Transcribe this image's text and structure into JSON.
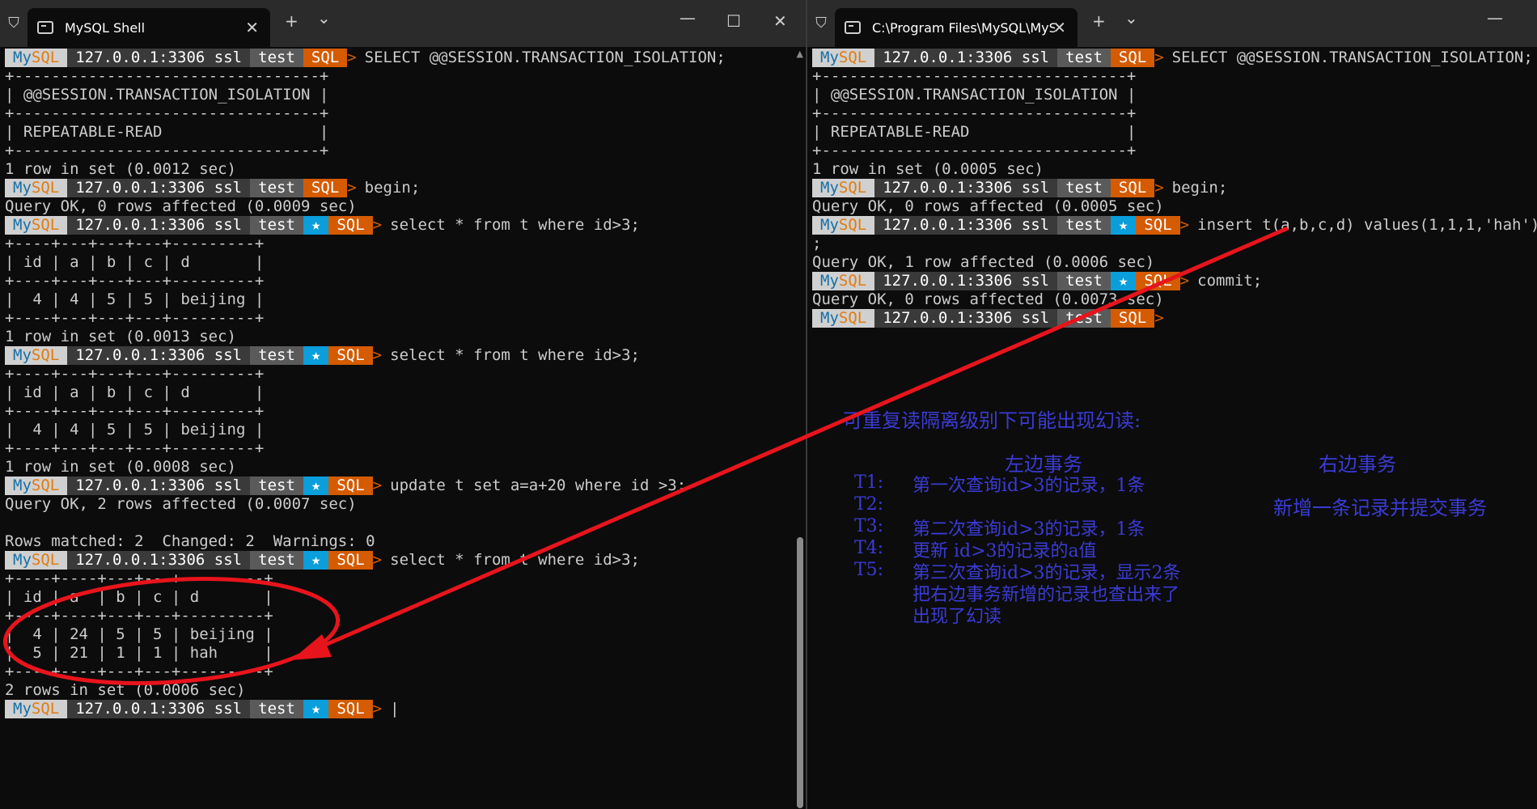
{
  "left_window": {
    "tab_title": "MySQL Shell",
    "lines": [
      {
        "type": "prompt",
        "star": false,
        "cmd": "SELECT @@SESSION.TRANSACTION_ISOLATION;"
      },
      {
        "type": "text",
        "text": "+---------------------------------+"
      },
      {
        "type": "text",
        "text": "| @@SESSION.TRANSACTION_ISOLATION |"
      },
      {
        "type": "text",
        "text": "+---------------------------------+"
      },
      {
        "type": "text",
        "text": "| REPEATABLE-READ                 |"
      },
      {
        "type": "text",
        "text": "+---------------------------------+"
      },
      {
        "type": "text",
        "text": "1 row in set (0.0012 sec)"
      },
      {
        "type": "prompt",
        "star": false,
        "cmd": "begin;"
      },
      {
        "type": "text",
        "text": "Query OK, 0 rows affected (0.0009 sec)"
      },
      {
        "type": "prompt",
        "star": true,
        "cmd": "select * from t where id>3;"
      },
      {
        "type": "text",
        "text": "+----+---+---+---+---------+"
      },
      {
        "type": "text",
        "text": "| id | a | b | c | d       |"
      },
      {
        "type": "text",
        "text": "+----+---+---+---+---------+"
      },
      {
        "type": "text",
        "text": "|  4 | 4 | 5 | 5 | beijing |"
      },
      {
        "type": "text",
        "text": "+----+---+---+---+---------+"
      },
      {
        "type": "text",
        "text": "1 row in set (0.0013 sec)"
      },
      {
        "type": "prompt",
        "star": true,
        "cmd": "select * from t where id>3;"
      },
      {
        "type": "text",
        "text": "+----+---+---+---+---------+"
      },
      {
        "type": "text",
        "text": "| id | a | b | c | d       |"
      },
      {
        "type": "text",
        "text": "+----+---+---+---+---------+"
      },
      {
        "type": "text",
        "text": "|  4 | 4 | 5 | 5 | beijing |"
      },
      {
        "type": "text",
        "text": "+----+---+---+---+---------+"
      },
      {
        "type": "text",
        "text": "1 row in set (0.0008 sec)"
      },
      {
        "type": "prompt",
        "star": true,
        "cmd": "update t set a=a+20 where id >3;"
      },
      {
        "type": "text",
        "text": "Query OK, 2 rows affected (0.0007 sec)"
      },
      {
        "type": "text",
        "text": ""
      },
      {
        "type": "text",
        "text": "Rows matched: 2  Changed: 2  Warnings: 0"
      },
      {
        "type": "prompt",
        "star": true,
        "cmd": "select * from t where id>3;"
      },
      {
        "type": "text",
        "text": "+----+----+---+---+---------+"
      },
      {
        "type": "text",
        "text": "| id | a  | b | c | d       |"
      },
      {
        "type": "text",
        "text": "+----+----+---+---+---------+"
      },
      {
        "type": "text",
        "text": "|  4 | 24 | 5 | 5 | beijing |"
      },
      {
        "type": "text",
        "text": "|  5 | 21 | 1 | 1 | hah     |"
      },
      {
        "type": "text",
        "text": "+----+----+---+---+---------+"
      },
      {
        "type": "text",
        "text": "2 rows in set (0.0006 sec)"
      },
      {
        "type": "prompt",
        "star": true,
        "cmd": "|"
      }
    ]
  },
  "right_window": {
    "tab_title": "C:\\Program Files\\MySQL\\MyS",
    "lines": [
      {
        "type": "prompt",
        "star": false,
        "cmd": "SELECT @@SESSION.TRANSACTION_ISOLATION;"
      },
      {
        "type": "text",
        "text": "+---------------------------------+"
      },
      {
        "type": "text",
        "text": "| @@SESSION.TRANSACTION_ISOLATION |"
      },
      {
        "type": "text",
        "text": "+---------------------------------+"
      },
      {
        "type": "text",
        "text": "| REPEATABLE-READ                 |"
      },
      {
        "type": "text",
        "text": "+---------------------------------+"
      },
      {
        "type": "text",
        "text": "1 row in set (0.0005 sec)"
      },
      {
        "type": "prompt",
        "star": false,
        "cmd": "begin;"
      },
      {
        "type": "text",
        "text": "Query OK, 0 rows affected (0.0005 sec)"
      },
      {
        "type": "prompt",
        "star": true,
        "cmd": "insert t(a,b,c,d) values(1,1,1,'hah')"
      },
      {
        "type": "text",
        "text": ";"
      },
      {
        "type": "text",
        "text": "Query OK, 1 row affected (0.0006 sec)"
      },
      {
        "type": "prompt",
        "star": true,
        "cmd": "commit;"
      },
      {
        "type": "text",
        "text": "Query OK, 0 rows affected (0.0073 sec)"
      },
      {
        "type": "prompt",
        "star": false,
        "cmd": ""
      }
    ]
  },
  "prompt": {
    "my": "My",
    "sql": "SQL",
    "host": "127.0.0.1:3306 ssl",
    "db": "test",
    "star": "★",
    "lang": "SQL",
    "arrow": ">"
  },
  "notes": {
    "heading": "可重复读隔离级别下可能出现幻读:",
    "left_col": "左边事务",
    "right_col": "右边事务",
    "t1_label": "T1:",
    "t1_text": "第一次查询id>3的记录，1条",
    "t2_label": "T2:",
    "t2_right": "新增一条记录并提交事务",
    "t3_label": "T3:",
    "t3_text": "第二次查询id>3的记录，1条",
    "t4_label": "T4:",
    "t4_text": "更新 id>3的记录的a值",
    "t5_label": "T5:",
    "t5_text": "第三次查询id>3的记录，显示2条",
    "t5_line2": "把右边事务新增的记录也查出来了",
    "t5_line3": "出现了幻读"
  },
  "titlebar_icons": {
    "new_tab": "+",
    "dropdown": "⌄",
    "minimize": "—",
    "maximize": "☐",
    "close": "✕",
    "tab_close": "✕",
    "shield": "⛉"
  },
  "colors": {
    "terminal_bg": "#0c0c0c",
    "annotation_red": "#e8141c",
    "note_blue": "#3b3bd6",
    "prompt_orange": "#d45b00",
    "prompt_star_blue": "#0a9edb"
  }
}
